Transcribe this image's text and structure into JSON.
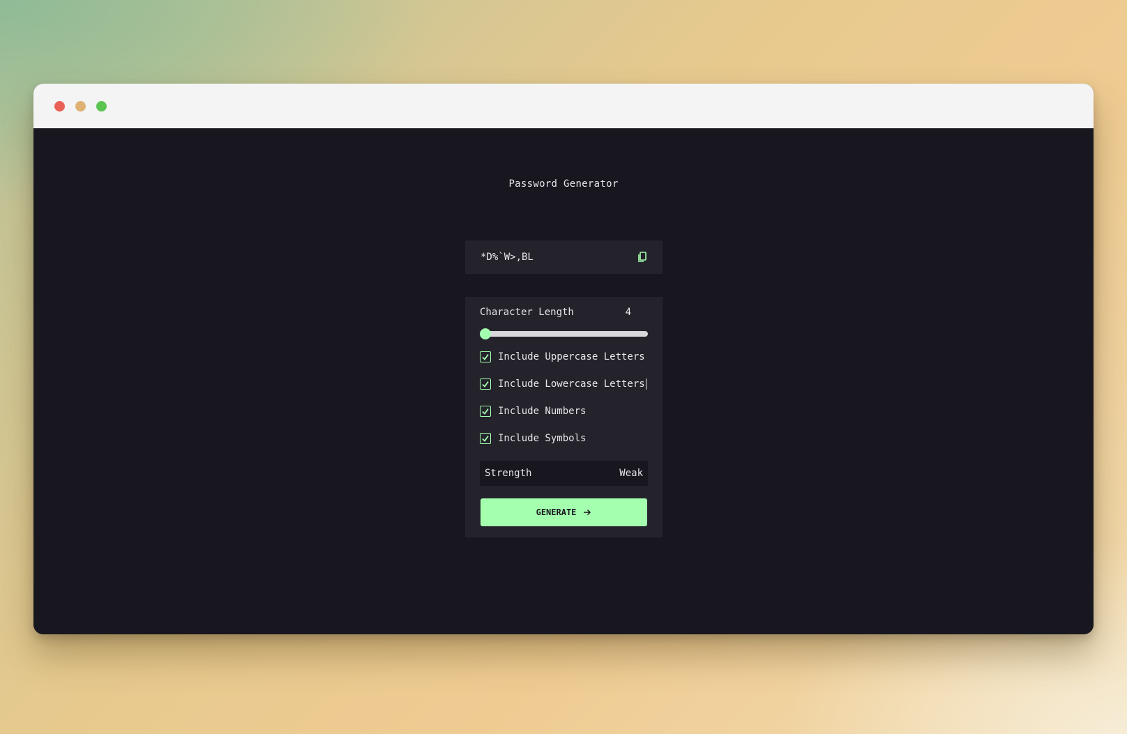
{
  "app": {
    "title": "Password Generator"
  },
  "password": {
    "value": "*D%`W>,BL",
    "copy_icon": "copy-icon"
  },
  "length": {
    "label": "Character Length",
    "value": "4",
    "slider_fraction": 0.03
  },
  "options": [
    {
      "label": "Include Uppercase Letters",
      "checked": true
    },
    {
      "label": "Include Lowercase Letters",
      "checked": true
    },
    {
      "label": "Include Numbers",
      "checked": true
    },
    {
      "label": "Include Symbols",
      "checked": true
    }
  ],
  "strength": {
    "label": "Strength",
    "value": "Weak"
  },
  "generate": {
    "label": "GENERATE",
    "icon": "arrow-right-icon"
  },
  "colors": {
    "accent": "#a4ffaf",
    "background": "#18171f",
    "panel": "#24232b",
    "text": "#e6e5ea"
  },
  "window_controls": [
    "close",
    "minimize",
    "maximize"
  ]
}
